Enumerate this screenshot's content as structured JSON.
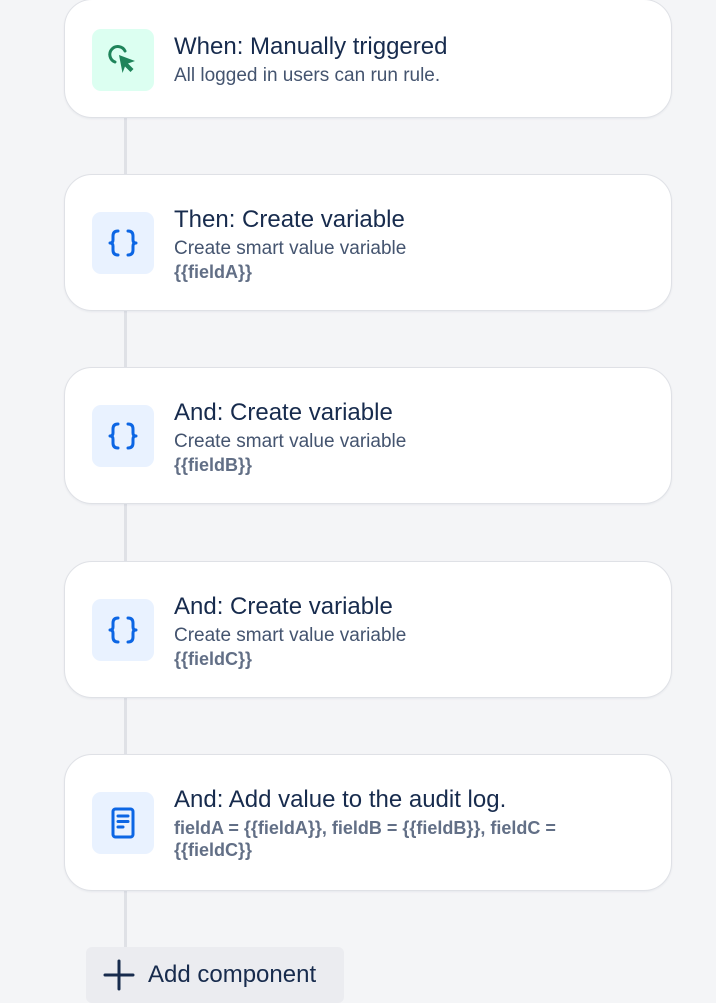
{
  "rule": {
    "steps": [
      {
        "title": "When: Manually triggered",
        "subtitle": "All logged in users can run rule.",
        "icon": "cursor-click-icon",
        "accent": "#1f845a"
      },
      {
        "title": "Then: Create variable",
        "subtitle": "Create smart value variable",
        "detail": "{{fieldA}}",
        "icon": "curly-braces-icon",
        "accent": "#0c66e4"
      },
      {
        "title": "And: Create variable",
        "subtitle": "Create smart value variable",
        "detail": "{{fieldB}}",
        "icon": "curly-braces-icon",
        "accent": "#0c66e4"
      },
      {
        "title": "And: Create variable",
        "subtitle": "Create smart value variable",
        "detail": "{{fieldC}}",
        "icon": "curly-braces-icon",
        "accent": "#0c66e4"
      },
      {
        "title": "And: Add value to the audit log.",
        "detail": "fieldA = {{fieldA}}, fieldB = {{fieldB}}, fieldC = {{fieldC}}",
        "icon": "document-icon",
        "accent": "#0c66e4"
      }
    ],
    "add_component_label": "Add component"
  }
}
